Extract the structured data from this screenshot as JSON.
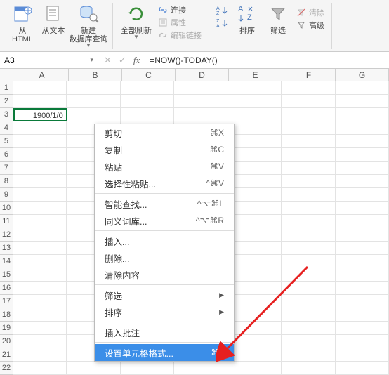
{
  "ribbon": {
    "from_html": "从\nHTML",
    "from_text": "从文本",
    "new_db_query": "新建\n数据库查询",
    "refresh_all": "全部刷新",
    "connections": "连接",
    "properties": "属性",
    "edit_links": "编辑链接",
    "sort_asc": "A→Z",
    "sort_desc": "Z→A",
    "sort": "排序",
    "filter": "筛选",
    "clear": "清除",
    "advanced": "高级"
  },
  "namebox": {
    "ref": "A3"
  },
  "formula_bar": {
    "value": "=NOW()-TODAY()"
  },
  "columns": [
    "A",
    "B",
    "C",
    "D",
    "E",
    "F",
    "G"
  ],
  "rows": [
    1,
    2,
    3,
    4,
    5,
    6,
    7,
    8,
    9,
    10,
    11,
    12,
    13,
    14,
    15,
    16,
    17,
    18,
    19,
    20,
    21,
    22
  ],
  "cells": {
    "A3": "1900/1/0"
  },
  "context_menu": {
    "items": [
      {
        "label": "剪切",
        "shortcut": "⌘X"
      },
      {
        "label": "复制",
        "shortcut": "⌘C"
      },
      {
        "label": "粘贴",
        "shortcut": "⌘V"
      },
      {
        "label": "选择性粘贴...",
        "shortcut": "^⌘V"
      },
      {
        "sep": true
      },
      {
        "label": "智能查找...",
        "shortcut": "^⌥⌘L"
      },
      {
        "label": "同义词库...",
        "shortcut": "^⌥⌘R"
      },
      {
        "sep": true
      },
      {
        "label": "插入..."
      },
      {
        "label": "删除..."
      },
      {
        "label": "清除内容"
      },
      {
        "sep": true
      },
      {
        "label": "筛选",
        "submenu": true
      },
      {
        "label": "排序",
        "submenu": true
      },
      {
        "sep": true
      },
      {
        "label": "插入批注"
      },
      {
        "sep": true
      },
      {
        "label": "设置单元格格式...",
        "shortcut": "⌘1",
        "highlight": true
      }
    ]
  }
}
